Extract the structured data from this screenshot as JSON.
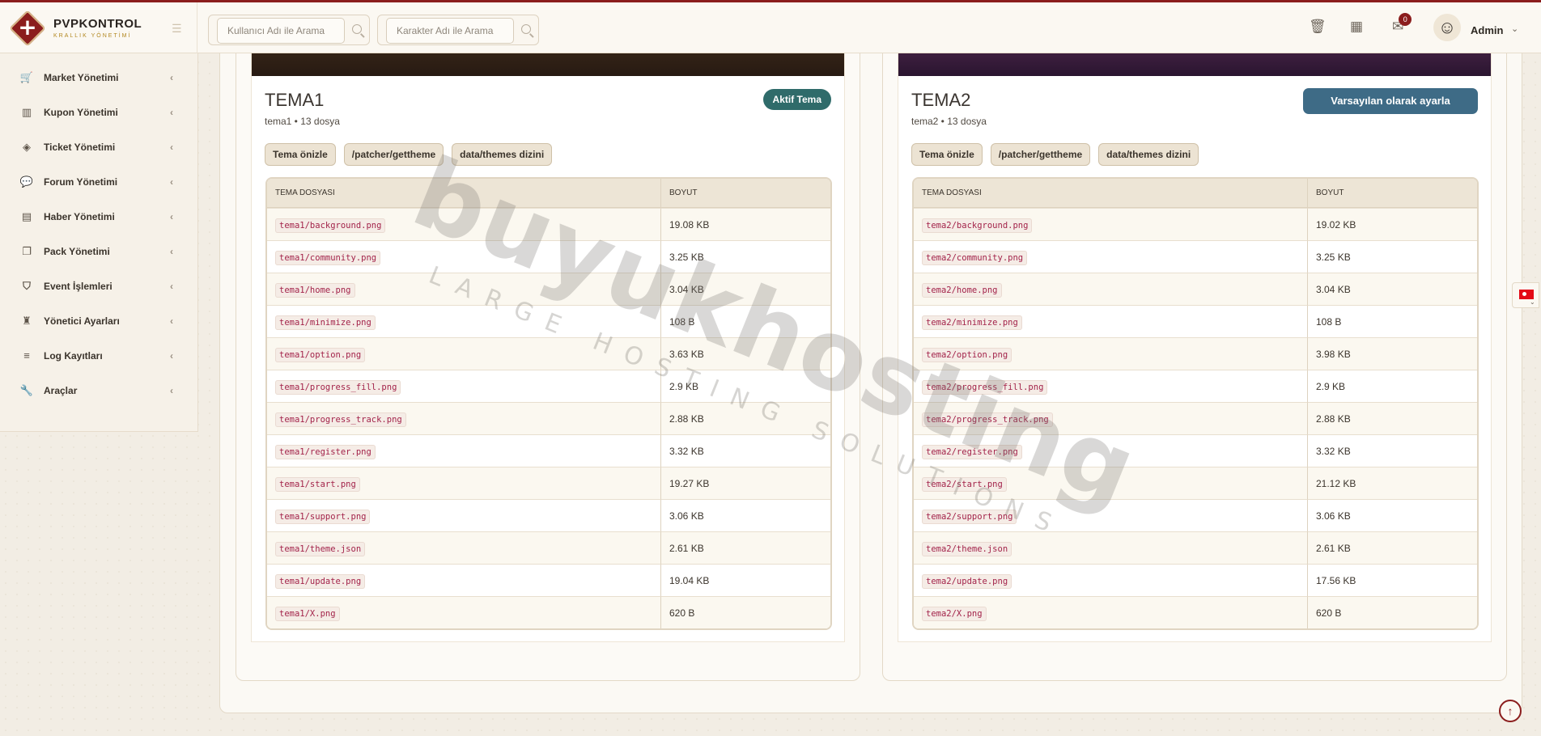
{
  "brand": {
    "name": "PVPKONTROL",
    "subtitle": "KRALLIK YÖNETİMİ"
  },
  "search": {
    "user_placeholder": "Kullanıcı Adı ile Arama",
    "character_placeholder": "Karakter Adı ile Arama"
  },
  "header": {
    "notification_count": "0",
    "admin_name": "Admin",
    "icons": [
      "trash-icon",
      "calendar-icon",
      "inbox-icon",
      "avatar",
      "chevron-down-icon"
    ]
  },
  "sidebar": {
    "items": [
      {
        "label": "Market Yönetimi",
        "icon": "cart-icon"
      },
      {
        "label": "Kupon Yönetimi",
        "icon": "barcode-icon"
      },
      {
        "label": "Ticket Yönetimi",
        "icon": "tag-icon"
      },
      {
        "label": "Forum Yönetimi",
        "icon": "comments-icon"
      },
      {
        "label": "Haber Yönetimi",
        "icon": "newspaper-icon"
      },
      {
        "label": "Pack Yönetimi",
        "icon": "copy-icon"
      },
      {
        "label": "Event İşlemleri",
        "icon": "shield-icon"
      },
      {
        "label": "Yönetici Ayarları",
        "icon": "user-tie-icon"
      },
      {
        "label": "Log Kayıtları",
        "icon": "list-icon"
      },
      {
        "label": "Araçlar",
        "icon": "wrench-icon"
      }
    ]
  },
  "themes": [
    {
      "title": "TEMA1",
      "meta": "tema1 • 13 dosya",
      "action_label": "Aktif Tema",
      "active": true,
      "chips": [
        "Tema önizle",
        "/patcher/gettheme",
        "data/themes dizini"
      ],
      "columns": [
        "TEMA DOSYASI",
        "BOYUT"
      ],
      "files": [
        [
          "tema1/background.png",
          "19.08 KB"
        ],
        [
          "tema1/community.png",
          "3.25 KB"
        ],
        [
          "tema1/home.png",
          "3.04 KB"
        ],
        [
          "tema1/minimize.png",
          "108 B"
        ],
        [
          "tema1/option.png",
          "3.63 KB"
        ],
        [
          "tema1/progress_fill.png",
          "2.9 KB"
        ],
        [
          "tema1/progress_track.png",
          "2.88 KB"
        ],
        [
          "tema1/register.png",
          "3.32 KB"
        ],
        [
          "tema1/start.png",
          "19.27 KB"
        ],
        [
          "tema1/support.png",
          "3.06 KB"
        ],
        [
          "tema1/theme.json",
          "2.61 KB"
        ],
        [
          "tema1/update.png",
          "19.04 KB"
        ],
        [
          "tema1/X.png",
          "620 B"
        ]
      ]
    },
    {
      "title": "TEMA2",
      "meta": "tema2 • 13 dosya",
      "action_label": "Varsayılan olarak ayarla",
      "active": false,
      "chips": [
        "Tema önizle",
        "/patcher/gettheme",
        "data/themes dizini"
      ],
      "columns": [
        "TEMA DOSYASI",
        "BOYUT"
      ],
      "files": [
        [
          "tema2/background.png",
          "19.02 KB"
        ],
        [
          "tema2/community.png",
          "3.25 KB"
        ],
        [
          "tema2/home.png",
          "3.04 KB"
        ],
        [
          "tema2/minimize.png",
          "108 B"
        ],
        [
          "tema2/option.png",
          "3.98 KB"
        ],
        [
          "tema2/progress_fill.png",
          "2.9 KB"
        ],
        [
          "tema2/progress_track.png",
          "2.88 KB"
        ],
        [
          "tema2/register.png",
          "3.32 KB"
        ],
        [
          "tema2/start.png",
          "21.12 KB"
        ],
        [
          "tema2/support.png",
          "3.06 KB"
        ],
        [
          "tema2/theme.json",
          "2.61 KB"
        ],
        [
          "tema2/update.png",
          "17.56 KB"
        ],
        [
          "tema2/X.png",
          "620 B"
        ]
      ]
    }
  ],
  "watermark": {
    "main": "buyukhosting",
    "sub": "LARGE HOSTING SOLUTIONS"
  },
  "colors": {
    "brand_red": "#8b1d1d",
    "active_teal": "#2f6b6a",
    "default_blue": "#3e6b86",
    "filename_pink": "#a3234a"
  }
}
